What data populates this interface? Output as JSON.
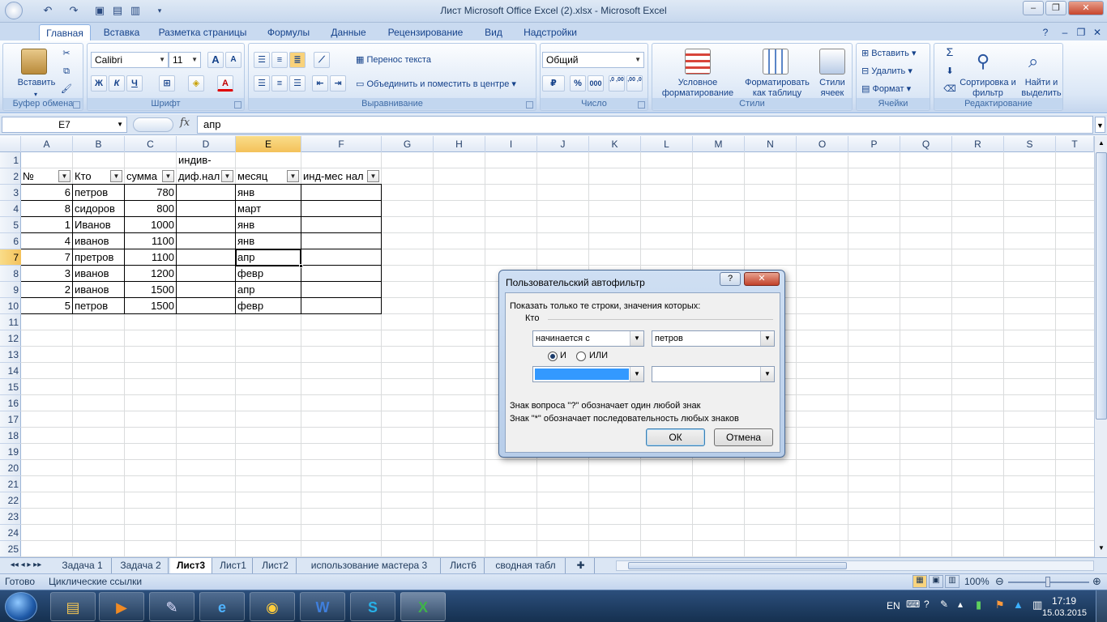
{
  "window": {
    "title": "Лист Microsoft Office Excel (2).xlsx - Microsoft Excel",
    "minimize": "–",
    "restore": "❐",
    "close": "✕"
  },
  "ribbon_tabs": [
    "Главная",
    "Вставка",
    "Разметка страницы",
    "Формулы",
    "Данные",
    "Рецензирование",
    "Вид",
    "Надстройки"
  ],
  "ribbon": {
    "clipboard": {
      "label": "Буфер обмена",
      "paste": "Вставить"
    },
    "font": {
      "label": "Шрифт",
      "name": "Calibri",
      "size": "11",
      "bold": "Ж",
      "italic": "К",
      "underline": "Ч",
      "grow": "A",
      "shrink": "A",
      "color_glyph": "A"
    },
    "align": {
      "label": "Выравнивание",
      "wrap": "Перенос текста",
      "merge": "Объединить и поместить в центре"
    },
    "number": {
      "label": "Число",
      "format": "Общий",
      "percent": "%",
      "thousands": "000",
      "inc": ",0 ,00",
      "dec": ",00 ,0"
    },
    "styles": {
      "label": "Стили",
      "conditional": "Условное форматирование",
      "as_table": "Форматировать как таблицу",
      "cell_styles": "Стили ячеек"
    },
    "cells": {
      "label": "Ячейки",
      "insert": "Вставить",
      "delete": "Удалить",
      "format": "Формат"
    },
    "editing": {
      "label": "Редактирование",
      "sigma": "Σ",
      "sort": "Сортировка и фильтр",
      "find": "Найти и выделить"
    }
  },
  "formula_bar": {
    "name_box": "E7",
    "fx": "fx",
    "value": "апр"
  },
  "columns": [
    "A",
    "B",
    "C",
    "D",
    "E",
    "F",
    "G",
    "H",
    "I",
    "J",
    "K",
    "L",
    "M",
    "N",
    "O",
    "P",
    "Q",
    "R",
    "S",
    "T"
  ],
  "rows": [
    "1",
    "2",
    "3",
    "4",
    "5",
    "6",
    "7",
    "8",
    "9",
    "10",
    "11",
    "12",
    "13",
    "14",
    "15",
    "16",
    "17",
    "18",
    "19",
    "20",
    "21",
    "22",
    "23",
    "24",
    "25"
  ],
  "table": {
    "header_top": {
      "D": "индив-"
    },
    "headers": [
      "№",
      "Кто",
      "сумма",
      "диф.нал",
      "месяц",
      "инд-мес нал"
    ],
    "rows": [
      {
        "n": "6",
        "who": "петров",
        "sum": "780",
        "month": "янв"
      },
      {
        "n": "8",
        "who": "сидоров",
        "sum": "800",
        "month": "март"
      },
      {
        "n": "1",
        "who": "Иванов",
        "sum": "1000",
        "month": "янв"
      },
      {
        "n": "4",
        "who": "иванов",
        "sum": "1100",
        "month": "янв"
      },
      {
        "n": "7",
        "who": "претров",
        "sum": "1100",
        "month": "апр"
      },
      {
        "n": "3",
        "who": "иванов",
        "sum": "1200",
        "month": "февр"
      },
      {
        "n": "2",
        "who": "иванов",
        "sum": "1500",
        "month": "апр"
      },
      {
        "n": "5",
        "who": "петров",
        "sum": "1500",
        "month": "февр"
      }
    ]
  },
  "sheet_tabs": [
    "Задача 1",
    "Задача 2",
    "Лист3",
    "Лист1",
    "Лист2",
    "использование мастера 3",
    "Лист6",
    "сводная табл"
  ],
  "active_sheet": "Лист3",
  "status": {
    "ready": "Готово",
    "circular": "Циклические ссылки",
    "zoom": "100%"
  },
  "taskbar": {
    "lang": "EN",
    "time": "17:19",
    "date": "15.03.2015"
  },
  "dialog": {
    "title": "Пользовательский автофильтр",
    "help": "?",
    "close": "✕",
    "prompt": "Показать только те строки, значения которых:",
    "field": "Кто",
    "cond1_op": "начинается с",
    "cond1_val": "петров",
    "and_label": "И",
    "or_label": "ИЛИ",
    "cond2_op": "",
    "cond2_val": "",
    "hint1": "Знак вопроса \"?\" обозначает один любой знак",
    "hint2": "Знак \"*\" обозначает последовательность любых знаков",
    "ok": "ОК",
    "cancel": "Отмена"
  },
  "colors": {
    "ribbon_blue": "#c9daf0",
    "select_orange": "#f4c15a",
    "taskbar": "#15304f"
  }
}
